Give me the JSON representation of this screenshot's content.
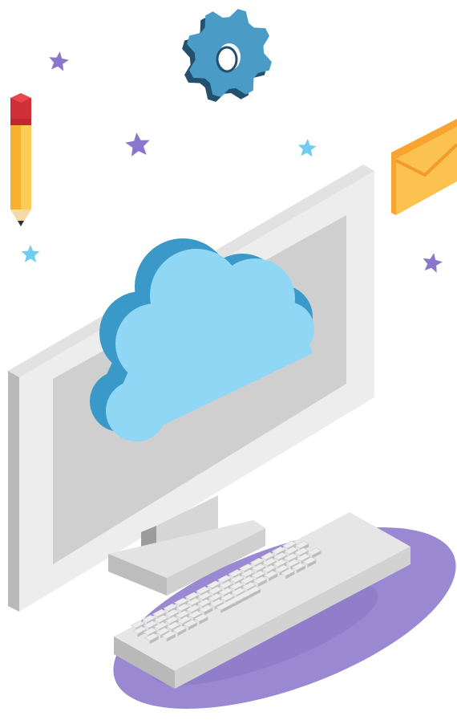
{
  "illustration": {
    "subject": "isometric-cloud-computing",
    "elements": [
      "gear-icon",
      "pencil-icon",
      "envelope-icon",
      "star-icon",
      "monitor",
      "cloud-icon",
      "keyboard",
      "platform-ellipse"
    ]
  },
  "colors": {
    "background": "#ffffff",
    "gear_face": "#4a9cc7",
    "gear_side": "#23506c",
    "cloud_front": "#8fd7f5",
    "cloud_side": "#3a99c8",
    "monitor_frame": "#ececec",
    "monitor_side": "#bdbdbd",
    "screen": "#cfcfcf",
    "platform": "#9a88d2",
    "pencil_body": "#fbc54e",
    "pencil_eraser": "#cf2f36",
    "envelope_front": "#fcc24f",
    "envelope_side": "#f7a530",
    "star_purple": "#8a77cd",
    "star_cyan": "#6fcdef",
    "key_top": "#ebebeb"
  }
}
